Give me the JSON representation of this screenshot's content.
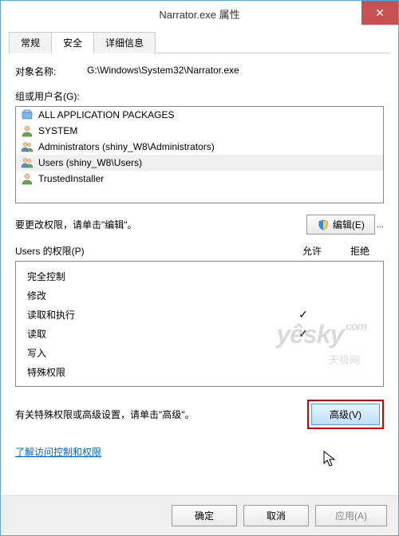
{
  "window": {
    "title": "Narrator.exe 属性",
    "close_glyph": "✕"
  },
  "tabs": {
    "general": "常规",
    "security": "安全",
    "details": "详细信息"
  },
  "object": {
    "label": "对象名称:",
    "value": "G:\\Windows\\System32\\Narrator.exe"
  },
  "groups": {
    "label": "组或用户名(G):",
    "items": [
      {
        "icon": "package",
        "name": "ALL APPLICATION PACKAGES"
      },
      {
        "icon": "user",
        "name": "SYSTEM"
      },
      {
        "icon": "users",
        "name": "Administrators (shiny_W8\\Administrators)"
      },
      {
        "icon": "users",
        "name": "Users (shiny_W8\\Users)",
        "selected": true
      },
      {
        "icon": "user",
        "name": "TrustedInstaller"
      }
    ]
  },
  "edit": {
    "text": "要更改权限，请单击\"编辑\"。",
    "button": "编辑(E)"
  },
  "permissions": {
    "header": "Users 的权限(P)",
    "allow": "允许",
    "deny": "拒绝",
    "rows": [
      {
        "label": "完全控制",
        "allow": false,
        "deny": false
      },
      {
        "label": "修改",
        "allow": false,
        "deny": false
      },
      {
        "label": "读取和执行",
        "allow": true,
        "deny": false
      },
      {
        "label": "读取",
        "allow": true,
        "deny": false
      },
      {
        "label": "写入",
        "allow": false,
        "deny": false
      },
      {
        "label": "特殊权限",
        "allow": false,
        "deny": false
      }
    ]
  },
  "advanced": {
    "text": "有关特殊权限或高级设置，请单击\"高级\"。",
    "button": "高级(V)"
  },
  "link": "了解访问控制和权限",
  "footer": {
    "ok": "确定",
    "cancel": "取消",
    "apply": "应用(A)"
  },
  "watermark": {
    "main": "yêsky",
    "sub": "天极网",
    "dotcom": ".com"
  }
}
